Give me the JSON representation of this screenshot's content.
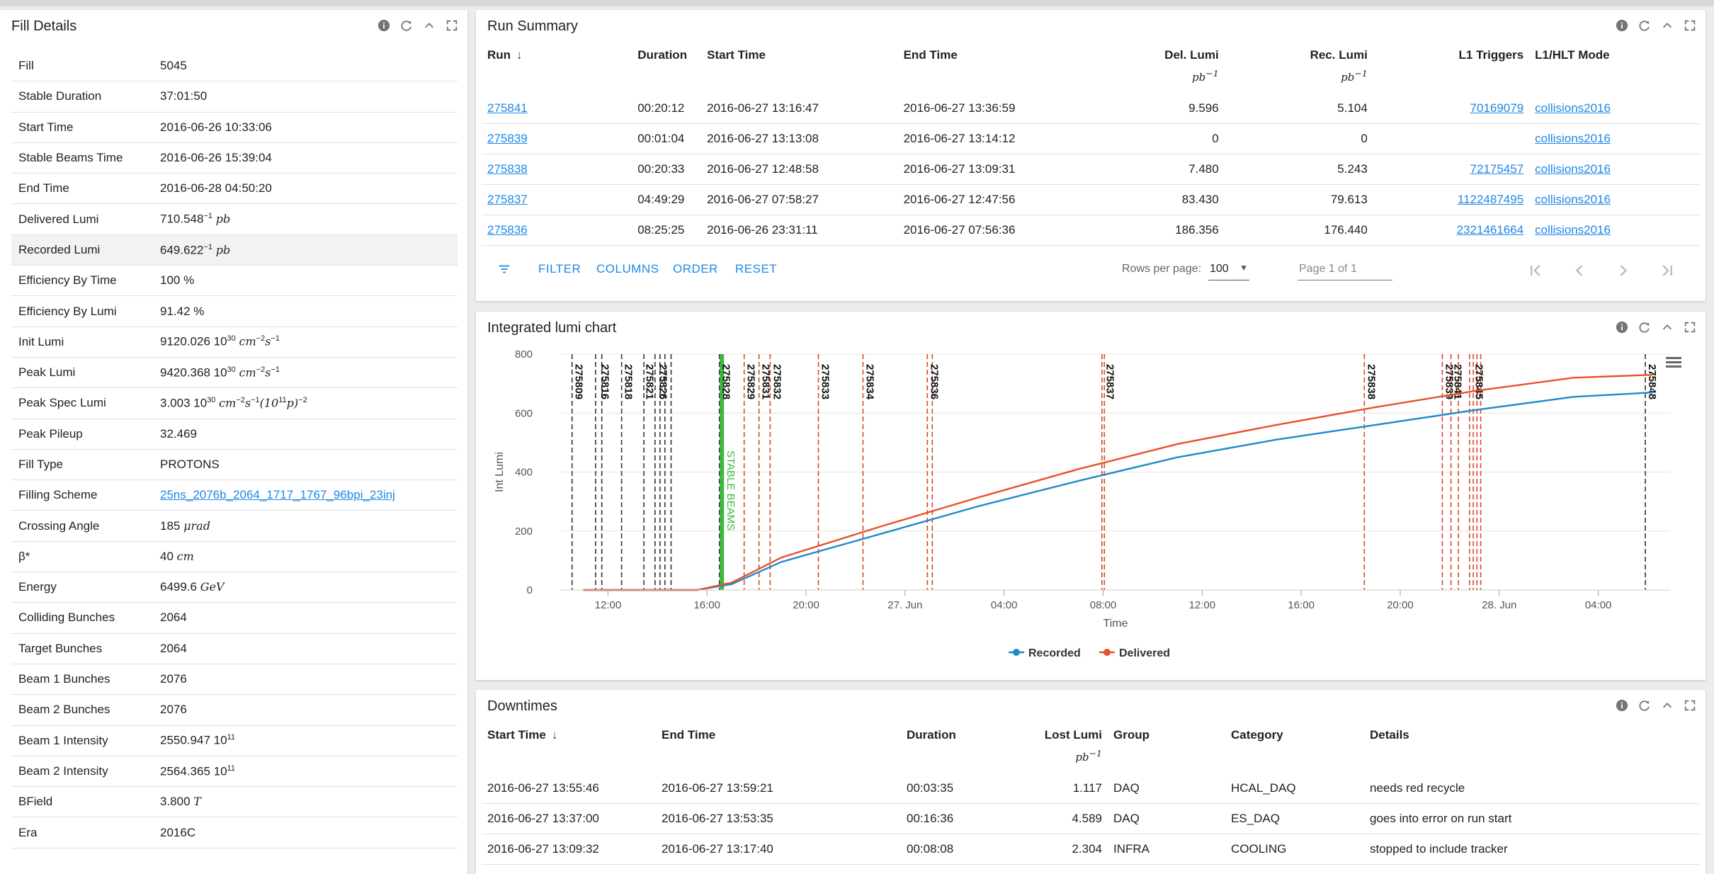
{
  "fill_details": {
    "title": "Fill Details",
    "rows": [
      {
        "key": "Fill",
        "value": "5045"
      },
      {
        "key": "Stable Duration",
        "value": "37:01:50"
      },
      {
        "key": "Start Time",
        "value": "2016-06-26 10:33:06"
      },
      {
        "key": "Stable Beams Time",
        "value": "2016-06-26 15:39:04"
      },
      {
        "key": "End Time",
        "value": "2016-06-28 04:50:20"
      },
      {
        "key": "Delivered Lumi",
        "value": "710.548",
        "unit": "pb",
        "sup": "−1"
      },
      {
        "key": "Recorded Lumi",
        "value": "649.622",
        "unit": "pb",
        "sup": "−1"
      },
      {
        "key": "Efficiency By Time",
        "value": "100 %"
      },
      {
        "key": "Efficiency By Lumi",
        "value": "91.42 %"
      },
      {
        "key": "Init Lumi",
        "value": "9120.026 10",
        "sup": "30",
        "unit": "cm",
        "sup2": "−2",
        "unit2": "s",
        "sup3": "−1"
      },
      {
        "key": "Peak Lumi",
        "value": "9420.368 10",
        "sup": "30",
        "unit": "cm",
        "sup2": "−2",
        "unit2": "s",
        "sup3": "−1"
      },
      {
        "key": "Peak Spec Lumi",
        "value": "3.003 10",
        "sup": "30",
        "unit": "cm",
        "sup2": "−2",
        "unit2": "s",
        "sup3": "−1",
        "tail": "(10",
        "tailsup": "11",
        "tail2": "p)",
        "tailsup2": "−2"
      },
      {
        "key": "Peak Pileup",
        "value": "32.469"
      },
      {
        "key": "Fill Type",
        "value": "PROTONS"
      },
      {
        "key": "Filling Scheme",
        "value": "25ns_2076b_2064_1717_1767_96bpi_23inj",
        "link": true
      },
      {
        "key": "Crossing Angle",
        "value": "185",
        "unit": "μrad"
      },
      {
        "key": "β*",
        "value": "40",
        "unit": "cm"
      },
      {
        "key": "Energy",
        "value": "6499.6",
        "unit": "GeV"
      },
      {
        "key": "Colliding Bunches",
        "value": "2064"
      },
      {
        "key": "Target Bunches",
        "value": "2064"
      },
      {
        "key": "Beam 1 Bunches",
        "value": "2076"
      },
      {
        "key": "Beam 2 Bunches",
        "value": "2076"
      },
      {
        "key": "Beam 1 Intensity",
        "value": "2550.947 10",
        "sup": "11"
      },
      {
        "key": "Beam 2 Intensity",
        "value": "2564.365 10",
        "sup": "11"
      },
      {
        "key": "BField",
        "value": "3.800",
        "unit": "T"
      },
      {
        "key": "Era",
        "value": "2016C"
      }
    ]
  },
  "run_summary": {
    "title": "Run Summary",
    "columns": [
      "Run",
      "Duration",
      "Start Time",
      "End Time",
      "Del. Lumi",
      "Rec. Lumi",
      "L1 Triggers",
      "L1/HLT Mode"
    ],
    "lumi_unit": "pb",
    "lumi_unit_sup": "−1",
    "rows": [
      {
        "run": "275841",
        "duration": "00:20:12",
        "start": "2016-06-27 13:16:47",
        "end": "2016-06-27 13:36:59",
        "del": "9.596",
        "rec": "5.104",
        "l1": "70169079",
        "mode": "collisions2016"
      },
      {
        "run": "275839",
        "duration": "00:01:04",
        "start": "2016-06-27 13:13:08",
        "end": "2016-06-27 13:14:12",
        "del": "0",
        "rec": "0",
        "l1": "",
        "mode": "collisions2016"
      },
      {
        "run": "275838",
        "duration": "00:20:33",
        "start": "2016-06-27 12:48:58",
        "end": "2016-06-27 13:09:31",
        "del": "7.480",
        "rec": "5.243",
        "l1": "72175457",
        "mode": "collisions2016"
      },
      {
        "run": "275837",
        "duration": "04:49:29",
        "start": "2016-06-27 07:58:27",
        "end": "2016-06-27 12:47:56",
        "del": "83.430",
        "rec": "79.613",
        "l1": "1122487495",
        "mode": "collisions2016"
      },
      {
        "run": "275836",
        "duration": "08:25:25",
        "start": "2016-06-26 23:31:11",
        "end": "2016-06-27 07:56:36",
        "del": "186.356",
        "rec": "176.440",
        "l1": "2321461664",
        "mode": "collisions2016"
      }
    ],
    "toolbar": {
      "filter": "FILTER",
      "columns": "COLUMNS",
      "order": "ORDER",
      "reset": "RESET",
      "rows_per_page_label": "Rows per page:",
      "rows_per_page": "100",
      "page_text": "Page 1 of 1"
    }
  },
  "lumi_chart": {
    "title": "Integrated lumi chart",
    "stable_beams_label": "STABLE BEAMS",
    "run_markers": [
      "275809",
      "275816",
      "275818",
      "275821",
      "275826",
      "275828",
      "275829",
      "275831",
      "275832",
      "275833",
      "275834",
      "275836",
      "275837",
      "275838",
      "275839",
      "275841",
      "275845",
      "275848"
    ],
    "chart_data": {
      "type": "line",
      "xlabel": "Time",
      "ylabel": "Int Lumi",
      "ylim": [
        0,
        800
      ],
      "yticks": [
        0,
        200,
        400,
        600,
        800
      ],
      "xticks": [
        "12:00",
        "16:00",
        "20:00",
        "27. Jun",
        "04:00",
        "08:00",
        "12:00",
        "16:00",
        "20:00",
        "28. Jun",
        "04:00"
      ],
      "x_hours": [
        0,
        4.6,
        6.0,
        8.0,
        12.0,
        16.0,
        20.0,
        24.0,
        28.0,
        32.0,
        36.0,
        40.0,
        43.2
      ],
      "series": [
        {
          "name": "Recorded",
          "color": "#1f8ac8",
          "values": [
            0,
            0,
            20,
            95,
            190,
            285,
            370,
            450,
            510,
            560,
            610,
            655,
            670
          ]
        },
        {
          "name": "Delivered",
          "color": "#e8502a",
          "values": [
            0,
            0,
            25,
            110,
            215,
            315,
            410,
            495,
            560,
            620,
            675,
            720,
            730
          ]
        }
      ],
      "grid": true,
      "legend": "bottom-center"
    }
  },
  "downtimes": {
    "title": "Downtimes",
    "columns": [
      "Start Time",
      "End Time",
      "Duration",
      "Lost Lumi",
      "Group",
      "Category",
      "Details"
    ],
    "lumi_unit": "pb",
    "lumi_unit_sup": "−1",
    "rows": [
      {
        "start": "2016-06-27 13:55:46",
        "end": "2016-06-27 13:59:21",
        "duration": "00:03:35",
        "lost": "1.117",
        "group": "DAQ",
        "category": "HCAL_DAQ",
        "details": "needs red recycle"
      },
      {
        "start": "2016-06-27 13:37:00",
        "end": "2016-06-27 13:53:35",
        "duration": "00:16:36",
        "lost": "4.589",
        "group": "DAQ",
        "category": "ES_DAQ",
        "details": "goes into error on run start"
      },
      {
        "start": "2016-06-27 13:09:32",
        "end": "2016-06-27 13:17:40",
        "duration": "00:08:08",
        "lost": "2.304",
        "group": "INFRA",
        "category": "COOLING",
        "details": "stopped to include tracker"
      }
    ]
  },
  "colors": {
    "accent": "#1e88e5",
    "recorded": "#1f8ac8",
    "delivered": "#e8502a",
    "stable_beams": "#3cb83c"
  }
}
